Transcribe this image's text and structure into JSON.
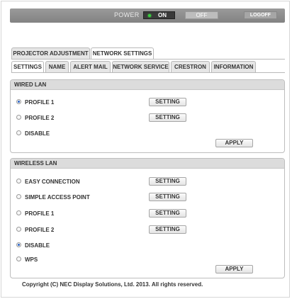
{
  "power": {
    "label": "POWER",
    "on_label": "ON",
    "off_label": "OFF",
    "logoff_label": "LOGOFF",
    "state": "on",
    "led_color": "#36d13c"
  },
  "main_tabs": [
    {
      "label": "PROJECTOR ADJUSTMENT",
      "active": false
    },
    {
      "label": "NETWORK SETTINGS",
      "active": true
    }
  ],
  "sub_tabs": [
    {
      "label": "SETTINGS",
      "active": true
    },
    {
      "label": "NAME",
      "active": false
    },
    {
      "label": "ALERT MAIL",
      "active": false
    },
    {
      "label": "NETWORK SERVICE",
      "active": false
    },
    {
      "label": "CRESTRON",
      "active": false
    },
    {
      "label": "INFORMATION",
      "active": false
    }
  ],
  "wired_lan": {
    "title": "WIRED LAN",
    "options": [
      {
        "label": "PROFILE 1",
        "selected": true,
        "button": "SETTING"
      },
      {
        "label": "PROFILE 2",
        "selected": false,
        "button": "SETTING"
      },
      {
        "label": "DISABLE",
        "selected": false
      }
    ],
    "apply_label": "APPLY"
  },
  "wireless_lan": {
    "title": "WIRELESS LAN",
    "options": [
      {
        "label": "EASY CONNECTION",
        "selected": false,
        "button": "SETTING"
      },
      {
        "label": "SIMPLE ACCESS POINT",
        "selected": false,
        "button": "SETTING"
      },
      {
        "label": "PROFILE 1",
        "selected": false,
        "button": "SETTING"
      },
      {
        "label": "PROFILE 2",
        "selected": false,
        "button": "SETTING"
      },
      {
        "label": "DISABLE",
        "selected": true
      },
      {
        "label": "WPS",
        "selected": false
      }
    ],
    "apply_label": "APPLY"
  },
  "copyright": "Copyright (C) NEC Display Solutions, Ltd. 2013. All rights reserved.",
  "colors": {
    "accent_radio": "#2a64c5",
    "header_bg": "#dcdcdc",
    "powerbar_bg": "#8e8e8e"
  }
}
